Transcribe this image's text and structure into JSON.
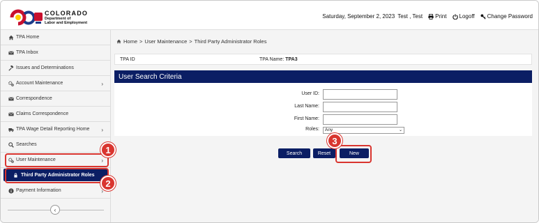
{
  "header": {
    "brand_name": "COLORADO",
    "brand_sub_1": "Department of",
    "brand_sub_2": "Labor and Employment",
    "date": "Saturday, September 2, 2023",
    "user": "Test , Test",
    "print_label": "Print",
    "logoff_label": "Logoff",
    "change_password_label": "Change Password"
  },
  "sidebar": {
    "items": [
      {
        "label": "TPA Home",
        "icon": "home-icon",
        "chevron": false
      },
      {
        "label": "TPA Inbox",
        "icon": "envelope-icon",
        "chevron": false
      },
      {
        "label": "Issues and Determinations",
        "icon": "gavel-icon",
        "chevron": false
      },
      {
        "label": "Account Maintenance",
        "icon": "gears-icon",
        "chevron": true
      },
      {
        "label": "Correspondence",
        "icon": "envelope-icon",
        "chevron": false
      },
      {
        "label": "Claims Correspondence",
        "icon": "envelope-icon",
        "chevron": false
      },
      {
        "label": "TPA Wage Detail Reporting Home",
        "icon": "truck-icon",
        "chevron": true
      },
      {
        "label": "Searches",
        "icon": "search-icon",
        "chevron": true
      },
      {
        "label": "User Maintenance",
        "icon": "gears-icon",
        "chevron": true
      },
      {
        "label": "Payment Information",
        "icon": "info-icon",
        "chevron": true
      }
    ],
    "sub_item": {
      "label": "Third Party Administrator Roles",
      "icon": "user-lock-icon"
    },
    "collapse_glyph": "‹"
  },
  "breadcrumb": {
    "home": "Home",
    "sep1": ">",
    "level1": "User Maintenance",
    "sep2": ">",
    "current": "Third Party Administrator Roles"
  },
  "tpa": {
    "id_label": "TPA ID",
    "name_label": "TPA Name:",
    "name_value": "TPA3"
  },
  "section_title": "User Search Criteria",
  "form": {
    "user_id_label": "User ID:",
    "user_id_value": "",
    "last_name_label": "Last Name:",
    "last_name_value": "",
    "first_name_label": "First Name:",
    "first_name_value": "",
    "roles_label": "Roles:",
    "roles_value": "Any"
  },
  "buttons": {
    "search": "Search",
    "reset": "Reset",
    "new": "New"
  },
  "callouts": {
    "one": "1",
    "two": "2",
    "three": "3"
  },
  "colors": {
    "navy": "#0b1e64",
    "callout_red": "#d9352f"
  }
}
